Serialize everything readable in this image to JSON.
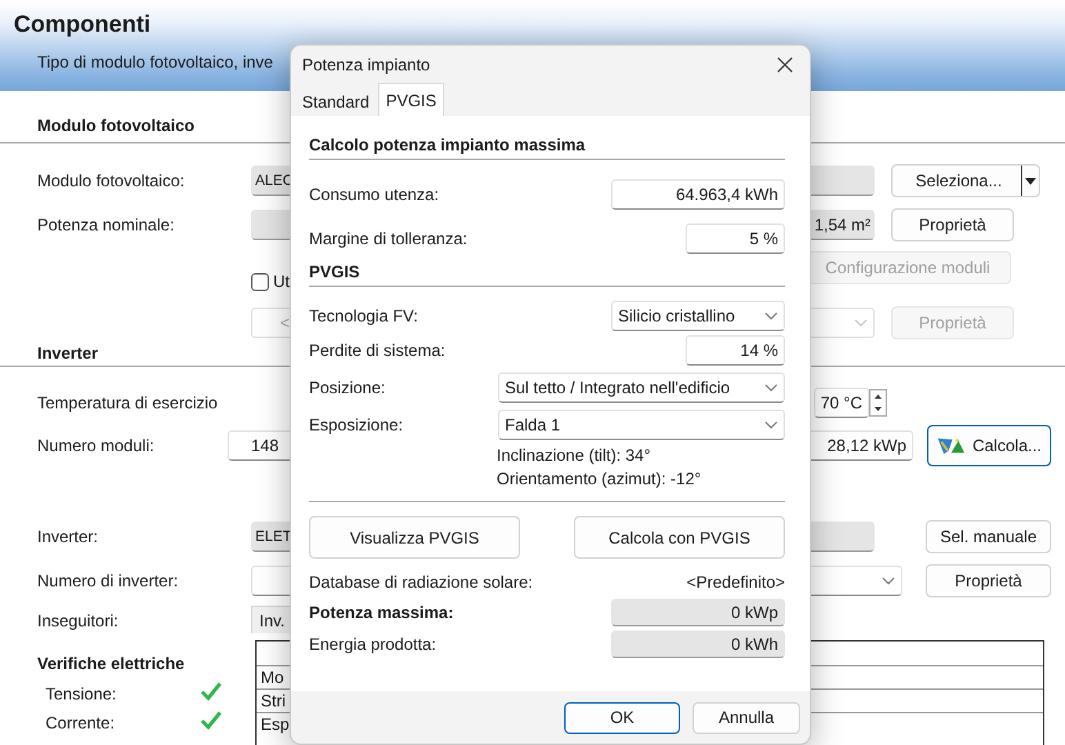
{
  "header": {
    "title": "Componenti",
    "subtitle": "Tipo di modulo fotovoltaico, inve"
  },
  "module": {
    "title": "Modulo fotovoltaico",
    "module_label": "Modulo fotovoltaico:",
    "module_value": "ALEC",
    "select_button": "Seleziona...",
    "power_label": "Potenza nominale:",
    "area_value": "1,54 m²",
    "properties_button": {
      "label": "Proprietà",
      "disabled": false
    },
    "option_checkbox": {
      "label": "Ut",
      "checked": false
    },
    "config_button": {
      "label": "Configurazione moduli",
      "disabled": true
    },
    "option_select": {
      "value": "<",
      "disabled": true
    },
    "option_properties_button": {
      "label": "Proprietà",
      "disabled": true
    }
  },
  "inverter": {
    "title": "Inverter",
    "temperature_label": "Temperatura di esercizio",
    "temperature_value": "70 °C",
    "modules_label": "Numero moduli:",
    "modules_value": "148",
    "peak_power": "28,12 kWp",
    "calculate_button": "Calcola...",
    "inverter_label": "Inverter:",
    "inverter_value": "ELET",
    "manual_button": "Sel. manuale",
    "count_label": "Numero di inverter:",
    "count_properties_button": "Proprietà",
    "trackers_label": "Inseguitori:",
    "trackers_tab": "Inv.",
    "table_rows": [
      "Mo",
      "Stri",
      "Esp"
    ]
  },
  "checks": {
    "title": "Verifiche elettriche",
    "items": [
      {
        "label": "Tensione:",
        "passed": true
      },
      {
        "label": "Corrente:",
        "passed": true
      }
    ]
  },
  "dialog": {
    "title": "Potenza impianto",
    "tabs": [
      {
        "label": "Standard",
        "selected": false
      },
      {
        "label": "PVGIS",
        "selected": true
      }
    ],
    "calc_title": "Calcolo potenza impianto massima",
    "consumption": {
      "label": "Consumo utenza:",
      "value": "64.963,4 kWh"
    },
    "margin": {
      "label": "Margine di tolleranza:",
      "value": "5 %"
    },
    "pvgis_title": "PVGIS",
    "technology": {
      "label": "Tecnologia FV:",
      "value": "Silicio cristallino"
    },
    "losses": {
      "label": "Perdite di sistema:",
      "value": "14 %"
    },
    "position": {
      "label": "Posizione:",
      "value": "Sul tetto / Integrato nell'edificio"
    },
    "exposure": {
      "label": "Esposizione:",
      "value": "Falda 1"
    },
    "tilt": "Inclinazione (tilt): 34°",
    "azimuth": "Orientamento (azimut): -12°",
    "view_button": "Visualizza PVGIS",
    "calc_button": "Calcola con PVGIS",
    "database": {
      "label": "Database di radiazione solare:",
      "value": "<Predefinito>"
    },
    "max_power": {
      "label": "Potenza massima:",
      "value": "0 kWp"
    },
    "energy": {
      "label": "Energia prodotta:",
      "value": "0 kWh"
    },
    "ok_button": "OK",
    "cancel_button": "Annulla"
  }
}
